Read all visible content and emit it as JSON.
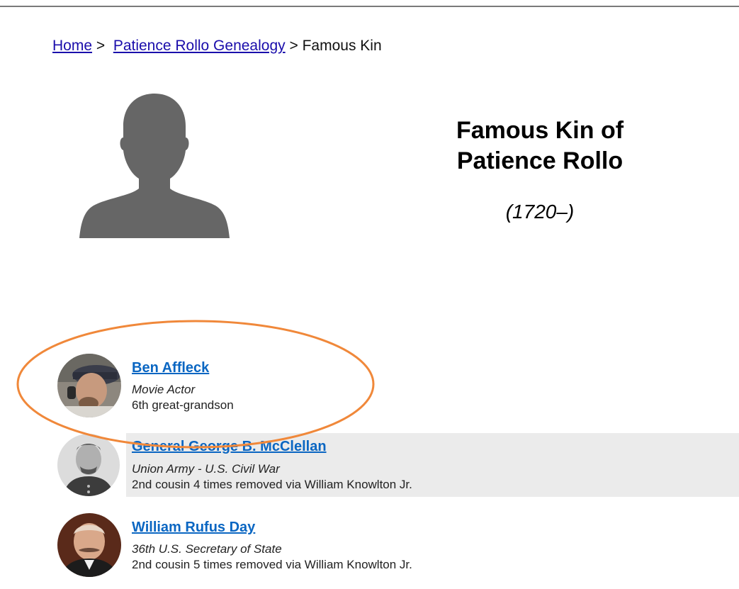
{
  "breadcrumb": {
    "home": "Home",
    "sep1": ">",
    "genealogy": "Patience Rollo Genealogy",
    "sep2": ">",
    "current": "Famous Kin"
  },
  "header": {
    "title_line1": "Famous Kin of",
    "title_line2": "Patience Rollo",
    "lifespan": "(1720–)"
  },
  "colors": {
    "link": "#0a66c2",
    "highlight": "#f0883a",
    "row_shade": "#ebebeb",
    "silhouette": "#666666"
  },
  "kin": [
    {
      "name": "Ben Affleck",
      "role": "Movie Actor",
      "relation": "6th great-grandson",
      "avatar": "ben-affleck-photo",
      "highlighted": true
    },
    {
      "name": "General George B. McClellan",
      "role": "Union Army - U.S. Civil War",
      "relation": "2nd cousin 4 times removed via William Knowlton Jr.",
      "avatar": "mcclellan-portrait",
      "shaded": true
    },
    {
      "name": "William Rufus Day",
      "role": "36th U.S. Secretary of State",
      "relation": "2nd cousin 5 times removed via William Knowlton Jr.",
      "avatar": "william-rufus-day-portrait"
    }
  ]
}
